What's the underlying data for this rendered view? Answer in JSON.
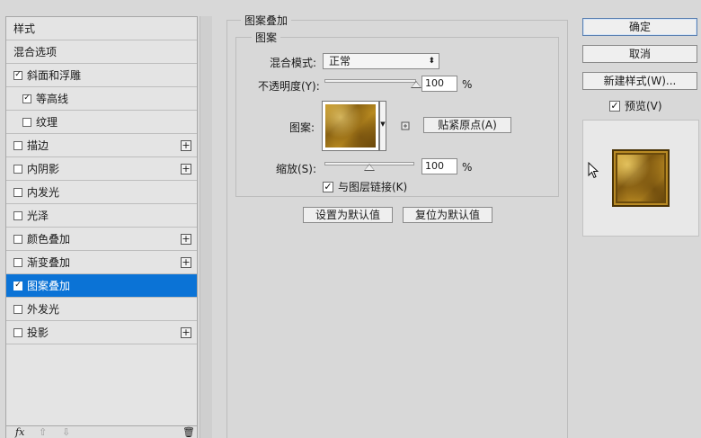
{
  "styles_panel": {
    "header": "样式",
    "items": [
      {
        "label": "混合选项",
        "checkbox": false,
        "checked": false,
        "sub": false,
        "plus": false,
        "selected": false
      },
      {
        "label": "斜面和浮雕",
        "checkbox": true,
        "checked": true,
        "sub": false,
        "plus": false,
        "selected": false
      },
      {
        "label": "等高线",
        "checkbox": true,
        "checked": true,
        "sub": true,
        "plus": false,
        "selected": false
      },
      {
        "label": "纹理",
        "checkbox": true,
        "checked": false,
        "sub": true,
        "plus": false,
        "selected": false
      },
      {
        "label": "描边",
        "checkbox": true,
        "checked": false,
        "sub": false,
        "plus": true,
        "selected": false
      },
      {
        "label": "内阴影",
        "checkbox": true,
        "checked": false,
        "sub": false,
        "plus": true,
        "selected": false
      },
      {
        "label": "内发光",
        "checkbox": true,
        "checked": false,
        "sub": false,
        "plus": false,
        "selected": false
      },
      {
        "label": "光泽",
        "checkbox": true,
        "checked": false,
        "sub": false,
        "plus": false,
        "selected": false
      },
      {
        "label": "颜色叠加",
        "checkbox": true,
        "checked": false,
        "sub": false,
        "plus": true,
        "selected": false
      },
      {
        "label": "渐变叠加",
        "checkbox": true,
        "checked": false,
        "sub": false,
        "plus": true,
        "selected": false
      },
      {
        "label": "图案叠加",
        "checkbox": true,
        "checked": true,
        "sub": false,
        "plus": false,
        "selected": true
      },
      {
        "label": "外发光",
        "checkbox": true,
        "checked": false,
        "sub": false,
        "plus": false,
        "selected": false
      },
      {
        "label": "投影",
        "checkbox": true,
        "checked": false,
        "sub": false,
        "plus": true,
        "selected": false
      }
    ],
    "footer": {
      "fx": "fx",
      "up": "⇧",
      "down": "⇩",
      "trash": "🗑"
    }
  },
  "pattern_overlay": {
    "section_title": "图案叠加",
    "group_title": "图案",
    "blend_mode_label": "混合模式:",
    "blend_mode_value": "正常",
    "opacity_label": "不透明度(Y):",
    "opacity_value": "100",
    "opacity_level": 1.0,
    "percent": "%",
    "pattern_label": "图案:",
    "snap_origin_button": "贴紧原点(A)",
    "scale_label": "缩放(S):",
    "scale_value": "100",
    "scale_level": 0.5,
    "link_with_layer_label": "与图层链接(K)",
    "link_with_layer_checked": true,
    "make_default_button": "设置为默认值",
    "reset_default_button": "复位为默认值"
  },
  "actions": {
    "ok": "确定",
    "cancel": "取消",
    "new_style": "新建样式(W)...",
    "preview_label": "预览(V)",
    "preview_checked": true
  },
  "colors": {
    "selected_row": "#0b73d6",
    "gold_light": "#d6a734",
    "gold_dark": "#5e3f08"
  }
}
